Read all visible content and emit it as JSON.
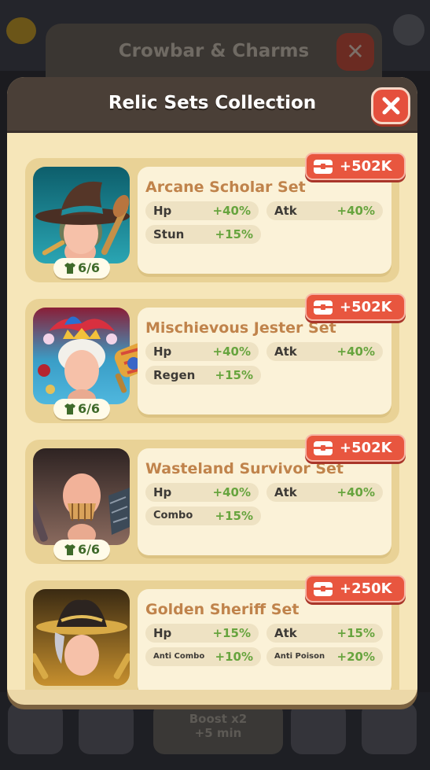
{
  "background": {
    "panel_title": "Crowbar & Charms",
    "boost": {
      "line1": "Boost x2",
      "line2": "+5 min"
    }
  },
  "modal": {
    "title": "Relic Sets Collection"
  },
  "sets": [
    {
      "name": "Arcane Scholar Set",
      "reward": "+502K",
      "count": "6/6",
      "stats": [
        {
          "name": "Hp",
          "value": "+40%"
        },
        {
          "name": "Atk",
          "value": "+40%"
        },
        {
          "name": "Stun",
          "value": "+15%"
        }
      ]
    },
    {
      "name": "Mischievous Jester Set",
      "reward": "+502K",
      "count": "6/6",
      "stats": [
        {
          "name": "Hp",
          "value": "+40%"
        },
        {
          "name": "Atk",
          "value": "+40%"
        },
        {
          "name": "Regen",
          "value": "+15%"
        }
      ]
    },
    {
      "name": "Wasteland Survivor Set",
      "reward": "+502K",
      "count": "6/6",
      "stats": [
        {
          "name": "Hp",
          "value": "+40%"
        },
        {
          "name": "Atk",
          "value": "+40%"
        },
        {
          "name": "Combo",
          "value": "+15%"
        }
      ]
    },
    {
      "name": "Golden Sheriff Set",
      "reward": "+250K",
      "stats": [
        {
          "name": "Hp",
          "value": "+15%"
        },
        {
          "name": "Atk",
          "value": "+15%"
        },
        {
          "name": "Anti Combo",
          "value": "+10%"
        },
        {
          "name": "Anti Poison",
          "value": "+20%"
        }
      ]
    }
  ],
  "colors": {
    "accent_red": "#e8563f",
    "stat_green": "#67a43e",
    "set_name": "#c0834b",
    "header": "#4a3f37"
  },
  "icons": {
    "close": "close-icon",
    "reward": "chest-icon",
    "count": "shirt-icon"
  }
}
